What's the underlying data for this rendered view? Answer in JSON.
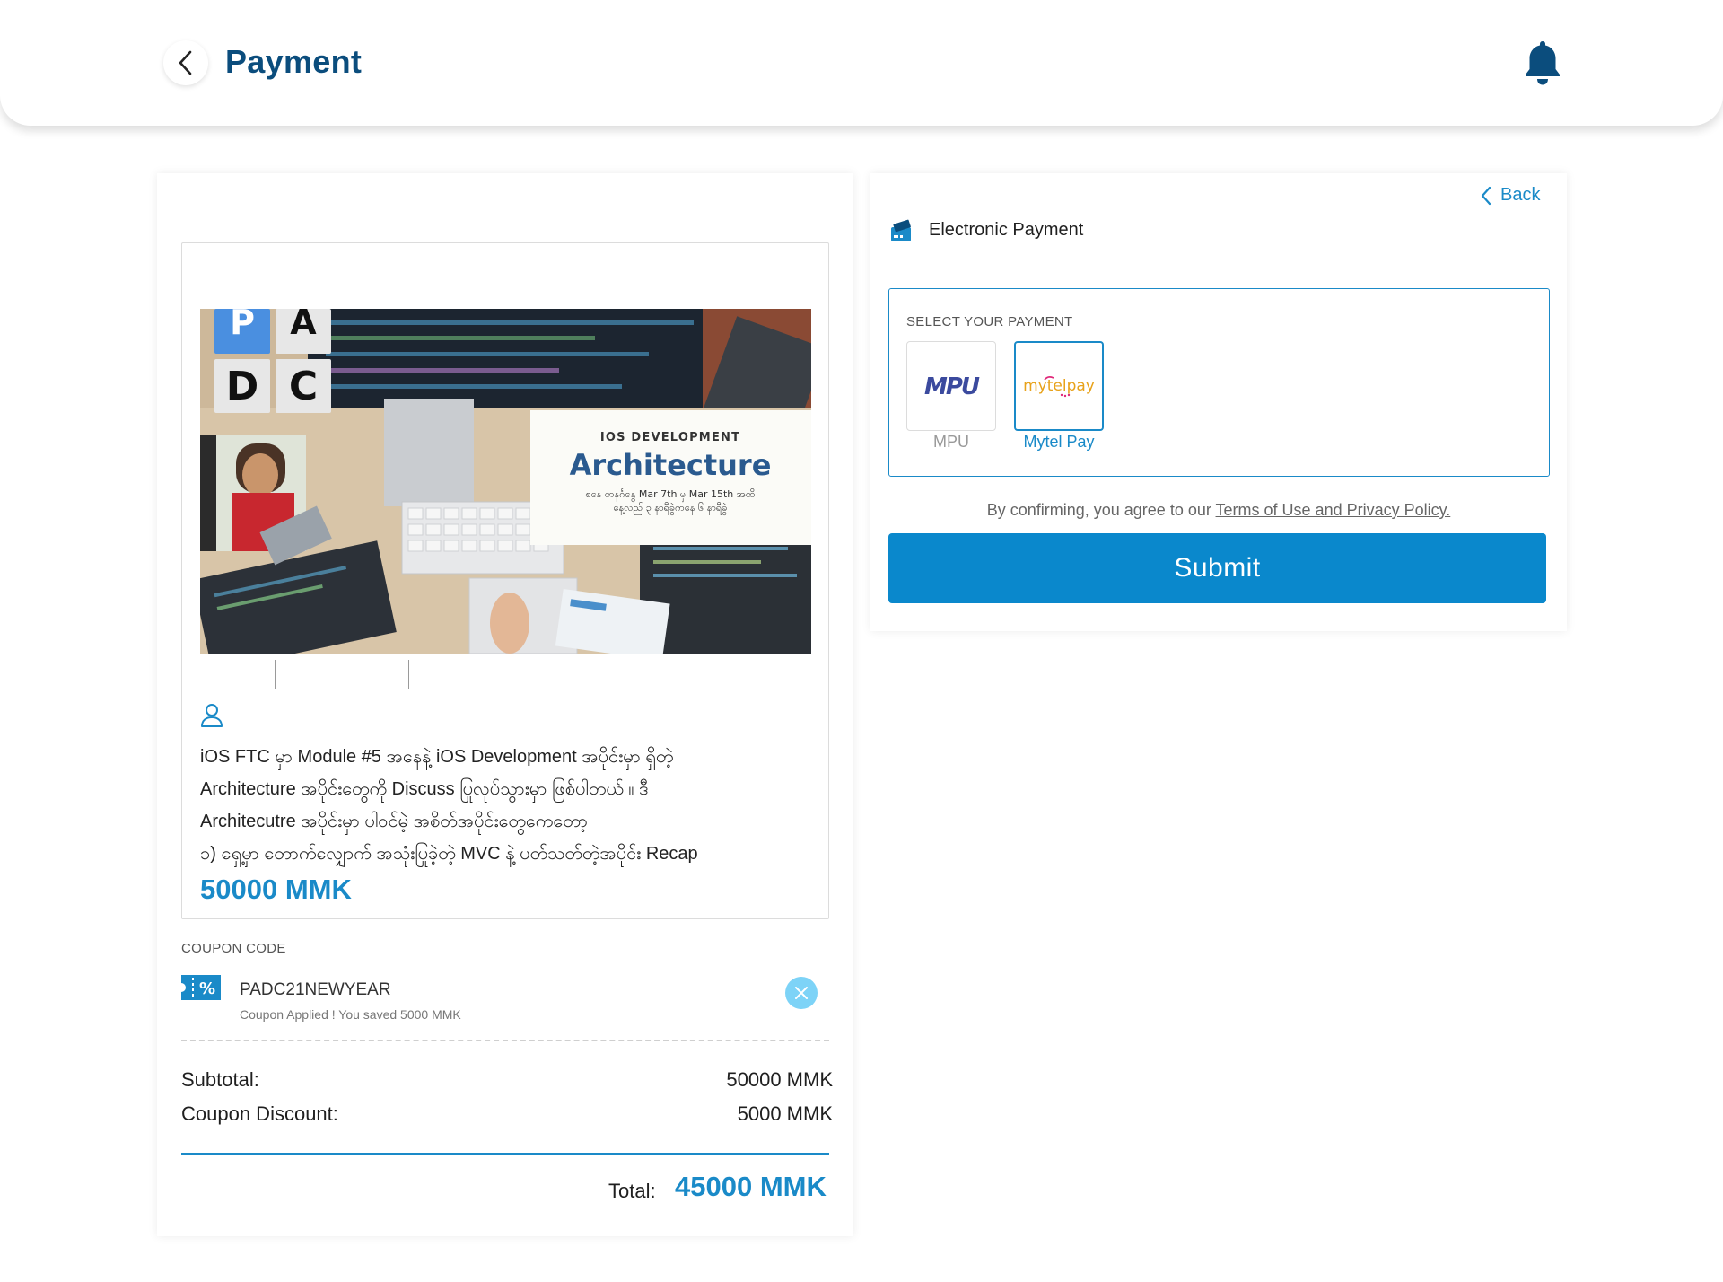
{
  "header": {
    "title": "Payment",
    "back_icon": "chevron-left-icon",
    "notification_icon": "bell-icon"
  },
  "course": {
    "banner": {
      "logo_letters": [
        "P",
        "A",
        "D",
        "C"
      ],
      "overline": "IOS DEVELOPMENT",
      "headline": "Architecture",
      "caption_line1": "စနေ တနင်္ဂနွေ Mar 7th မှ Mar 15th အထိ",
      "caption_line2": "နေ့လည် ၃ နာရီခွဲကနေ ၆ နာရီခွဲ"
    },
    "description": [
      "iOS FTC မှာ Module #5 အနေနဲ့ iOS Development အပိုင်းမှာ ရှိတဲ့",
      "Architecture အပိုင်းတွေကို Discuss ပြုလုပ်သွားမှာ ဖြစ်ပါတယ် ။ ဒီ",
      "Architecutre အပိုင်းမှာ ပါဝင်မဲ့ အစိတ်အပိုင်းတွေကေတော့",
      "၁) ရှေ့မှာ တောက်လျှောက် အသုံးပြုခဲ့တဲ့ MVC နဲ့ ပတ်သတ်တဲ့အပိုင်း Recap"
    ],
    "price": "50000 MMK"
  },
  "coupon": {
    "label": "COUPON CODE",
    "code": "PADC21NEWYEAR",
    "note": "Coupon Applied ! You saved 5000 MMK"
  },
  "summary": {
    "subtotal_label": "Subtotal:",
    "subtotal_value": "50000 MMK",
    "discount_label": "Coupon Discount:",
    "discount_value": "5000 MMK",
    "total_label": "Total:",
    "total_value": "45000 MMK"
  },
  "payment": {
    "back_label": "Back",
    "section_title": "Electronic Payment",
    "select_label": "SELECT YOUR PAYMENT",
    "options": [
      {
        "logo": "MPU",
        "label": "MPU",
        "selected": false
      },
      {
        "logo": "mytelpay",
        "label": "Mytel Pay",
        "selected": true
      }
    ],
    "terms_prefix": "By confirming, you agree to our ",
    "terms_link": "Terms of Use and Privacy Policy.",
    "submit_label": "Submit"
  },
  "colors": {
    "primary": "#1a8ac8",
    "title": "#0b4d7d",
    "submit": "#0a88cc"
  }
}
